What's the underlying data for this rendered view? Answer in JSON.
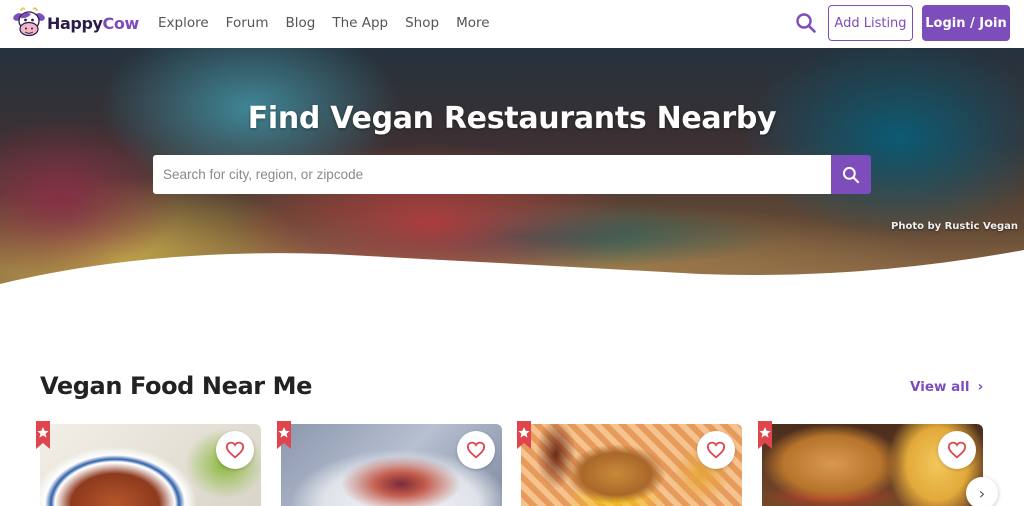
{
  "brand": {
    "part1": "Happy",
    "part2": "Cow"
  },
  "nav": {
    "items": [
      "Explore",
      "Forum",
      "Blog",
      "The App",
      "Shop",
      "More"
    ],
    "add_listing": "Add Listing",
    "login": "Login / Join"
  },
  "hero": {
    "title": "Find Vegan Restaurants Nearby",
    "search_placeholder": "Search for city, region, or zipcode",
    "search_value": "",
    "photo_credit": "Photo by Rustic Vegan"
  },
  "section": {
    "title": "Vegan Food Near Me",
    "view_all": "View all"
  },
  "cards": [
    {
      "image": "ramen bowl",
      "favorited": false
    },
    {
      "image": "plated dish",
      "favorited": false
    },
    {
      "image": "burger and cupcake",
      "favorited": false
    },
    {
      "image": "burger and fries",
      "favorited": false
    }
  ],
  "colors": {
    "brand": "#7c4dbb",
    "ribbon": "#e0454d",
    "heart": "#e0454d"
  },
  "icons": [
    "search-icon",
    "heart-icon",
    "ribbon-star-icon",
    "chevron-right-icon"
  ]
}
